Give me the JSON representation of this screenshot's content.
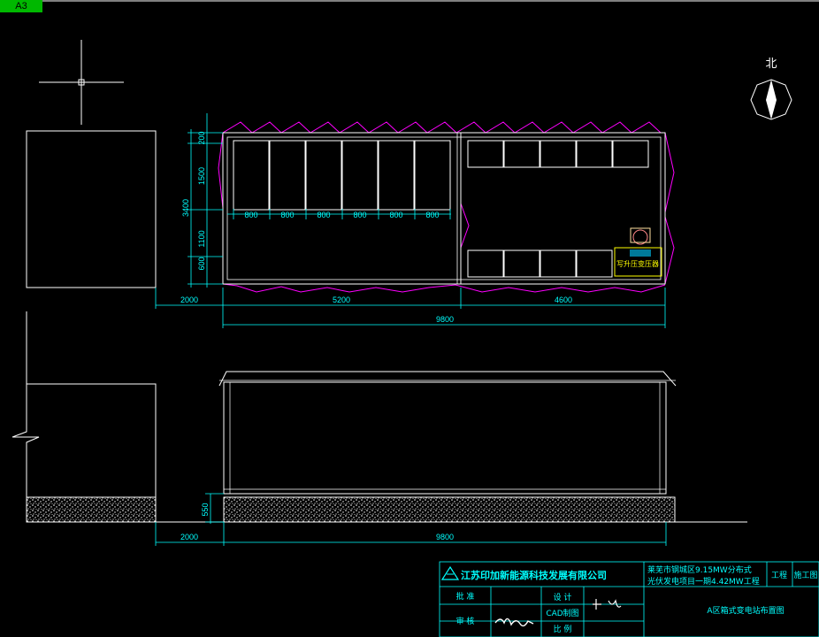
{
  "tab": {
    "label": "A3"
  },
  "compass": {
    "label": "北"
  },
  "plan": {
    "dims": {
      "d200": "200",
      "d1500": "1500",
      "d1100": "1100",
      "d600": "600",
      "d3400": "3400",
      "d800": [
        "800",
        "800",
        "800",
        "800",
        "800",
        "800"
      ],
      "d2000": "2000",
      "d5200": "5200",
      "d4600": "4600",
      "d9800": "9800"
    },
    "transformer_label": "写升压变压器"
  },
  "elevation": {
    "dims": {
      "d550": "550",
      "d2000": "2000",
      "d9800": "9800"
    }
  },
  "title_block": {
    "company": "江苏印加新能源科技发展有限公司",
    "project_line1": "莱芜市钢城区9.15MW分布式",
    "project_line2": "光伏发电项目一期4.42MW工程",
    "project_suffix": "工程",
    "stage": "施工图",
    "role_approve": "批 准",
    "role_review": "审 核",
    "role_design": "设 计",
    "role_cad": "CAD制图",
    "role_scale": "比 例",
    "drawing_title": "A区箱式变电站布置图"
  }
}
